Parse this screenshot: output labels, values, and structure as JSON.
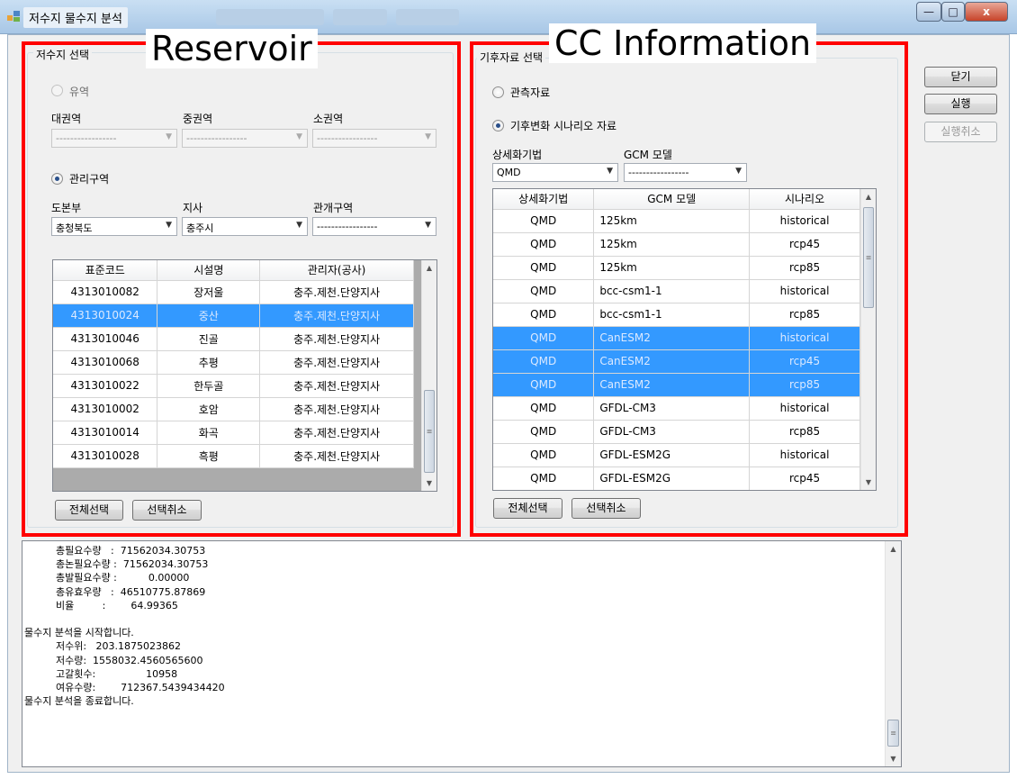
{
  "window": {
    "title": "저수지 물수지 분석",
    "controls": {
      "minimize": "—",
      "maximize": "□",
      "close": "x"
    }
  },
  "annotations": {
    "reservoir": "Reservoir",
    "cc_information": "CC Information"
  },
  "reservoir_panel": {
    "title": "저수지 선택",
    "basin_radio": "유역",
    "large_basin_label": "대권역",
    "mid_basin_label": "중권역",
    "small_basin_label": "소권역",
    "large_basin_value": "-----------------",
    "mid_basin_value": "-----------------",
    "small_basin_value": "-----------------",
    "mgmt_radio": "관리구역",
    "province_label": "도본부",
    "branch_label": "지사",
    "district_label": "관개구역",
    "province_value": "충청북도",
    "branch_value": "충주시",
    "district_value": "-----------------",
    "grid": {
      "columns": [
        "표준코드",
        "시설명",
        "관리자(공사)"
      ],
      "rows": [
        [
          "4313010082",
          "장저울",
          "충주.제천.단양지사"
        ],
        [
          "4313010024",
          "중산",
          "충주.제천.단양지사"
        ],
        [
          "4313010046",
          "진골",
          "충주.제천.단양지사"
        ],
        [
          "4313010068",
          "추평",
          "충주.제천.단양지사"
        ],
        [
          "4313010022",
          "한두골",
          "충주.제천.단양지사"
        ],
        [
          "4313010002",
          "호암",
          "충주.제천.단양지사"
        ],
        [
          "4313010014",
          "화곡",
          "충주.제천.단양지사"
        ],
        [
          "4313010028",
          "흑평",
          "충주.제천.단양지사"
        ]
      ],
      "selected_rows": [
        1
      ]
    },
    "select_all": "전체선택",
    "deselect": "선택취소"
  },
  "climate_panel": {
    "title": "기후자료 선택",
    "observed_radio": "관측자료",
    "scenario_radio": "기후변화 시나리오 자료",
    "downscale_label": "상세화기법",
    "gcm_label": "GCM 모델",
    "downscale_value": "QMD",
    "gcm_value": "-----------------",
    "grid": {
      "columns": [
        "상세화기법",
        "GCM 모델",
        "시나리오"
      ],
      "rows": [
        [
          "QMD",
          "125km",
          "historical"
        ],
        [
          "QMD",
          "125km",
          "rcp45"
        ],
        [
          "QMD",
          "125km",
          "rcp85"
        ],
        [
          "QMD",
          "bcc-csm1-1",
          "historical"
        ],
        [
          "QMD",
          "bcc-csm1-1",
          "rcp85"
        ],
        [
          "QMD",
          "CanESM2",
          "historical"
        ],
        [
          "QMD",
          "CanESM2",
          "rcp45"
        ],
        [
          "QMD",
          "CanESM2",
          "rcp85"
        ],
        [
          "QMD",
          "GFDL-CM3",
          "historical"
        ],
        [
          "QMD",
          "GFDL-CM3",
          "rcp85"
        ],
        [
          "QMD",
          "GFDL-ESM2G",
          "historical"
        ],
        [
          "QMD",
          "GFDL-ESM2G",
          "rcp45"
        ]
      ],
      "selected_rows": [
        5,
        6,
        7
      ]
    },
    "select_all": "전체선택",
    "deselect": "선택취소"
  },
  "side_buttons": {
    "close": "닫기",
    "run": "실행",
    "cancel_run": "실행취소"
  },
  "log": {
    "lines": [
      "          총필요수량   :  71562034.30753",
      "          총논필요수량 :  71562034.30753",
      "          총발필요수량 :          0.00000",
      "          총유효우량   :  46510775.87869",
      "          비율         :        64.99365",
      "",
      "물수지 분석을 시작합니다.",
      "          저수위:   203.1875023862",
      "          저수량:  1558032.4560565600",
      "          고갈횟수:                10958",
      "          여유수량:        712367.5439434420",
      "물수지 분석을 종료합니다."
    ]
  },
  "colors": {
    "annotation_border": "#ff0000",
    "selection": "#3399ff",
    "window_bg": "#f0f0f0"
  }
}
